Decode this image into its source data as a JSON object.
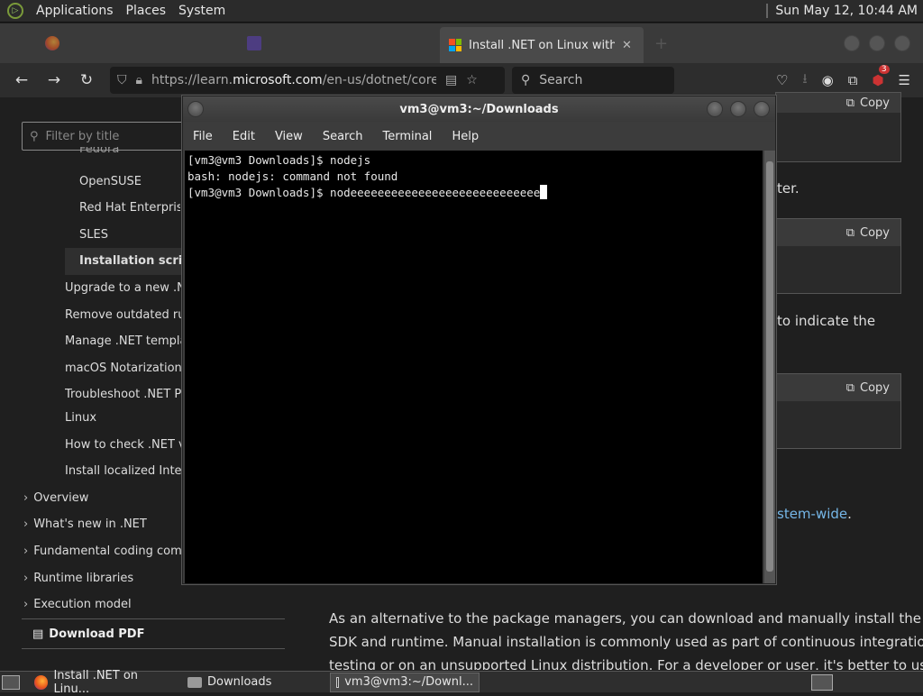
{
  "topbar": {
    "menus": [
      "Applications",
      "Places",
      "System"
    ],
    "clock": "Sun May 12, 10:44 AM"
  },
  "browser": {
    "tabs": [
      {
        "label": "",
        "active": false
      },
      {
        "label": "",
        "active": false
      },
      {
        "label": "Install .NET on Linux withou",
        "active": true
      }
    ],
    "url_prefix": "https://learn.",
    "url_domain": "microsoft.com",
    "url_path": "/en-us/dotnet/core/ins",
    "search_placeholder": "Search",
    "ext_badge": "3"
  },
  "sidebar": {
    "filter_placeholder": "Filter by title",
    "items": [
      "Fedora",
      "OpenSUSE",
      "Red Hat Enterprise",
      "SLES",
      "Installation script",
      "Upgrade to a new .NE",
      "Remove outdated run",
      "Manage .NET templa",
      "macOS Notarization is",
      "Troubleshoot .NET Pa",
      "Linux",
      "How to check .NET ve",
      "Install localized Intelli",
      "Overview",
      "What's new in .NET",
      "Fundamental coding comp",
      "Runtime libraries",
      "Execution model"
    ],
    "download_pdf": "Download PDF"
  },
  "content": {
    "copy_label": "Copy",
    "fragments": [
      "ter.",
      "to indicate the",
      "stem-wide",
      "."
    ],
    "para_lines": [
      "As an alternative to the package managers, you can download and manually install the",
      "SDK and runtime. Manual installation is commonly used as part of continuous integration",
      "testing or on an unsupported Linux distribution. For a developer or user, it's better to use"
    ]
  },
  "terminal": {
    "title": "vm3@vm3:~/Downloads",
    "menu": [
      "File",
      "Edit",
      "View",
      "Search",
      "Terminal",
      "Help"
    ],
    "lines": [
      "[vm3@vm3 Downloads]$ nodejs",
      "bash: nodejs: command not found",
      "[vm3@vm3 Downloads]$ nodeeeeeeeeeeeeeeeeeeeeeeeeeeee"
    ]
  },
  "taskbar": {
    "items": [
      "Install .NET on Linu...",
      "Downloads",
      "vm3@vm3:~/Downl..."
    ]
  }
}
